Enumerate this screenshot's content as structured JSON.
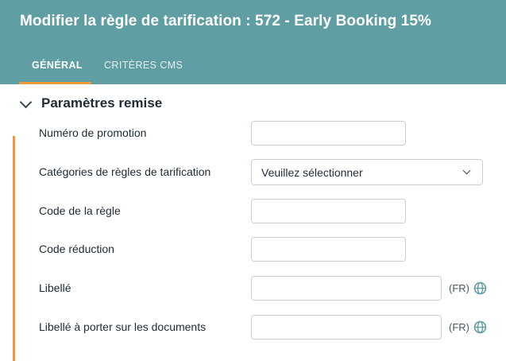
{
  "header": {
    "title": "Modifier la règle de tarification : 572 - Early Booking 15%",
    "tabs": [
      {
        "label": "GÉNÉRAL",
        "active": true
      },
      {
        "label": "CRITÈRES CMS",
        "active": false
      }
    ]
  },
  "section": {
    "title": "Paramètres remise",
    "chevron_icon": "chevron-down-icon"
  },
  "fields": {
    "promo_number": {
      "label": "Numéro de promotion",
      "value": ""
    },
    "rule_category": {
      "label": "Catégories de règles de tarification",
      "selected": "Veuillez sélectionner"
    },
    "rule_code": {
      "label": "Code de la règle",
      "value": ""
    },
    "discount_code": {
      "label": "Code réduction",
      "value": ""
    },
    "libelle": {
      "label": "Libellé",
      "value": "",
      "lang": "(FR)"
    },
    "libelle_docs": {
      "label": "Libellé à porter sur les documents",
      "value": "",
      "lang": "(FR)"
    }
  },
  "colors": {
    "header_bg": "#5f9ea3",
    "accent": "#f0993a",
    "globe": "#5f9ea3"
  }
}
